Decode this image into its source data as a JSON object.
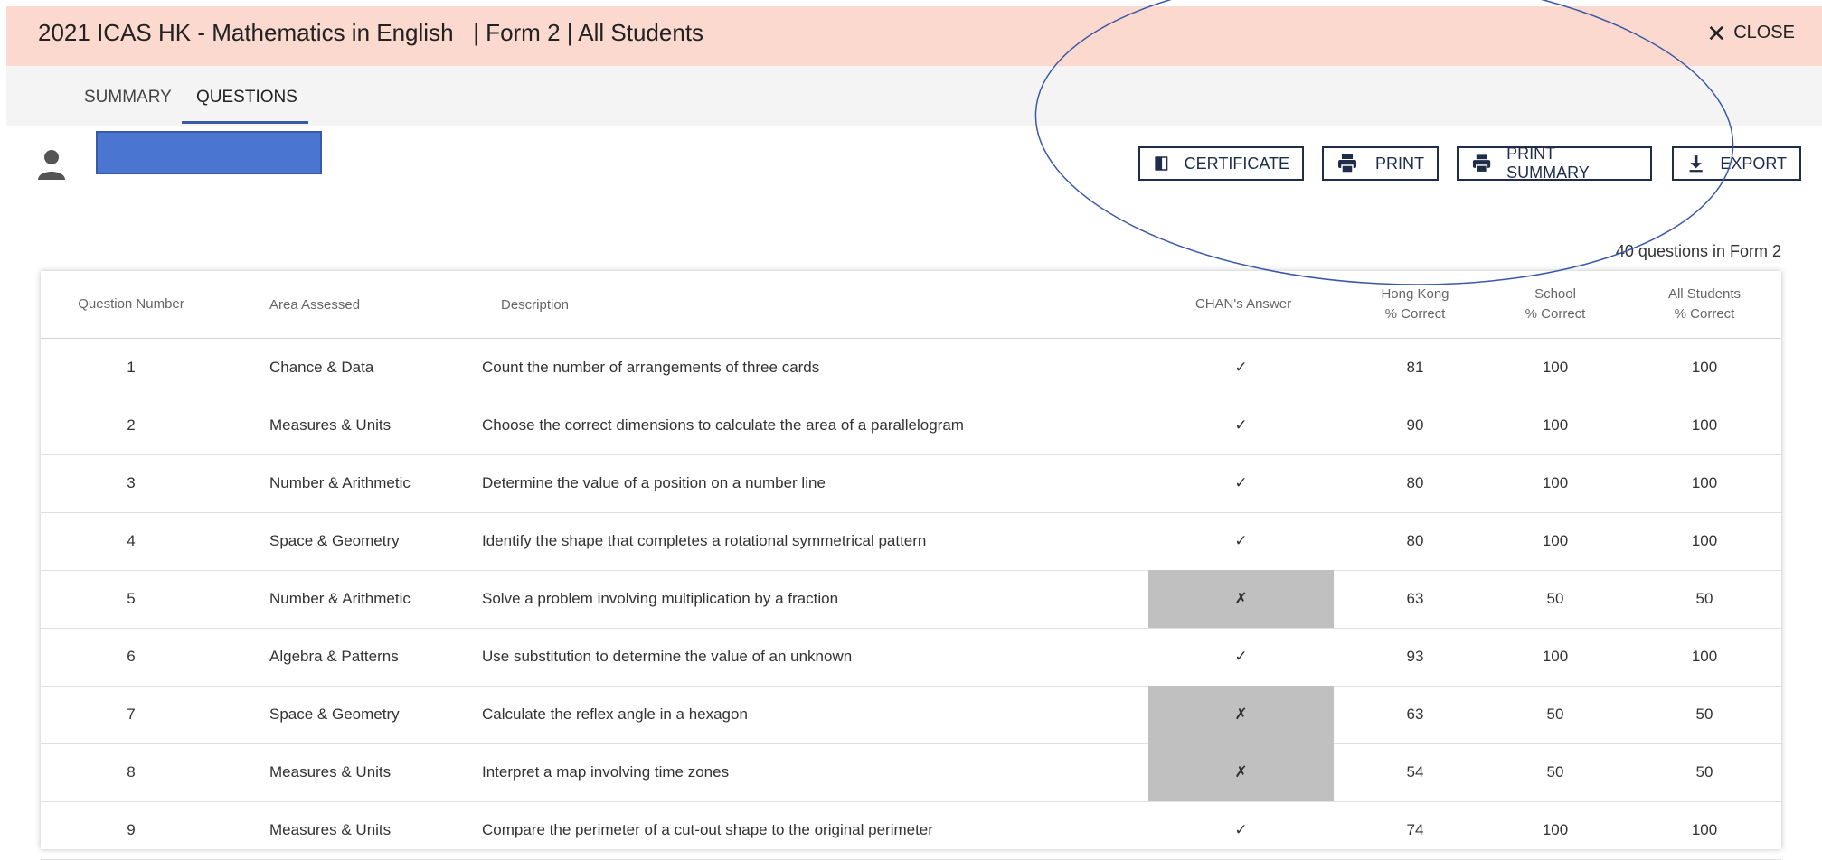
{
  "header": {
    "title": "2021 ICAS HK - Mathematics in English   | Form 2 | All Students",
    "close_label": "CLOSE"
  },
  "tabs": [
    {
      "label": "SUMMARY",
      "active": false
    },
    {
      "label": "QUESTIONS",
      "active": true
    }
  ],
  "toolbar": {
    "certificate_label": "CERTIFICATE",
    "print_label": "PRINT",
    "print_summary_label": "PRINT SUMMARY",
    "export_label": "EXPORT"
  },
  "question_count": "40 questions in Form 2",
  "table": {
    "columns": {
      "question_number": "Question Number",
      "area": "Area Assessed",
      "description": "Description",
      "answer": "CHAN's Answer",
      "hk_line1": "Hong Kong",
      "hk_line2": "% Correct",
      "school_line1": "School",
      "school_line2": "% Correct",
      "all_line1": "All Students",
      "all_line2": "% Correct"
    },
    "rows": [
      {
        "num": "1",
        "area": "Chance & Data",
        "desc": "Count the number of arrangements of three cards",
        "answer": "✓",
        "correct": true,
        "hk": "81",
        "school": "100",
        "all": "100"
      },
      {
        "num": "2",
        "area": "Measures & Units",
        "desc": "Choose the correct dimensions to calculate the area of a parallelogram",
        "answer": "✓",
        "correct": true,
        "hk": "90",
        "school": "100",
        "all": "100"
      },
      {
        "num": "3",
        "area": "Number & Arithmetic",
        "desc": "Determine the value of a position on a number line",
        "answer": "✓",
        "correct": true,
        "hk": "80",
        "school": "100",
        "all": "100"
      },
      {
        "num": "4",
        "area": "Space & Geometry",
        "desc": "Identify the shape that completes a rotational symmetrical pattern",
        "answer": "✓",
        "correct": true,
        "hk": "80",
        "school": "100",
        "all": "100"
      },
      {
        "num": "5",
        "area": "Number & Arithmetic",
        "desc": "Solve a problem involving multiplication by a fraction",
        "answer": "✗",
        "correct": false,
        "hk": "63",
        "school": "50",
        "all": "50"
      },
      {
        "num": "6",
        "area": "Algebra & Patterns",
        "desc": "Use substitution to determine the value of an unknown",
        "answer": "✓",
        "correct": true,
        "hk": "93",
        "school": "100",
        "all": "100"
      },
      {
        "num": "7",
        "area": "Space & Geometry",
        "desc": "Calculate the reflex angle in a hexagon",
        "answer": "✗",
        "correct": false,
        "hk": "63",
        "school": "50",
        "all": "50"
      },
      {
        "num": "8",
        "area": "Measures & Units",
        "desc": "Interpret a map involving time zones",
        "answer": "✗",
        "correct": false,
        "hk": "54",
        "school": "50",
        "all": "50"
      },
      {
        "num": "9",
        "area": "Measures & Units",
        "desc": "Compare the perimeter of a cut-out shape to the original perimeter",
        "answer": "✓",
        "correct": true,
        "hk": "74",
        "school": "100",
        "all": "100"
      }
    ]
  },
  "colors": {
    "title_bar": "#fbd9cf",
    "tab_bar": "#f4f4f4",
    "accent": "#3a58a6",
    "wrong_cell": "#c0c0c0",
    "redaction": "#4a76d2"
  }
}
